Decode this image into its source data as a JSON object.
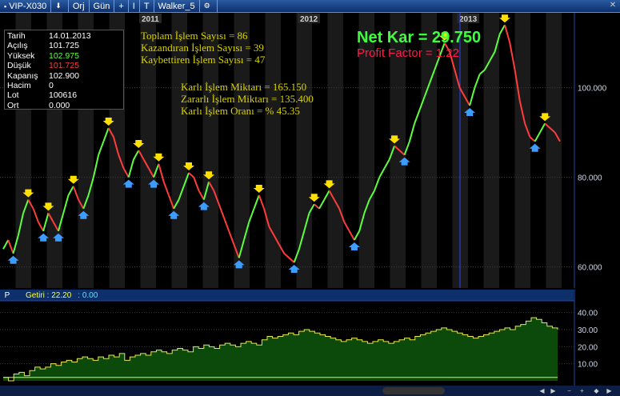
{
  "toolbar": {
    "symbol": "VIP-X030",
    "mode": "Orj",
    "period": "Gün",
    "plus_label": "+",
    "info_label": "I",
    "text_label": "T",
    "system": "Walker_5"
  },
  "info": {
    "rows": [
      {
        "k": "Tarih",
        "v": "14.01.2013"
      },
      {
        "k": "Açılış",
        "v": "101.725"
      },
      {
        "k": "Yüksek",
        "v": "102.975"
      },
      {
        "k": "Düşük",
        "v": "101.725"
      },
      {
        "k": "Kapanış",
        "v": "102.900"
      },
      {
        "k": "Hacim",
        "v": "0"
      },
      {
        "k": "Lot",
        "v": "100616"
      },
      {
        "k": "Ort",
        "v": "0.000"
      }
    ]
  },
  "stats": {
    "toplam": "Toplam İşlem Sayısı =  86",
    "kazandiran": "Kazandıran İşlem Sayısı =  39",
    "kaybettiren": "Kaybettiren İşlem Sayısı =  47",
    "karli_miktar": "Karlı İşlem Miktarı =  165.150",
    "zararli_miktar": "Zararlı İşlem Miktarı =  135.400",
    "karli_oran": "Karlı İşlem Oranı = % 45.35",
    "net_kar": "Net Kar =  29.750",
    "profit_factor": "Profit Factor =  1.22"
  },
  "sub": {
    "panel_label": "P",
    "getiri": "Getiri : 22.20",
    "zero": ": 0.00"
  },
  "colors": {
    "up": "#5cff3c",
    "down": "#ff3c3c",
    "buy_arrow": "#3c9cff",
    "sell_arrow": "#ffe000",
    "equity_fill": "#0c4a0c",
    "equity_line": "#e8e84a"
  },
  "chart_data": [
    {
      "type": "line",
      "title": "",
      "x_tick_labels": [
        "2011",
        "2012",
        "2013"
      ],
      "y_tick_labels": [
        "60.000",
        "80.000",
        "100.000"
      ],
      "ylim": [
        56,
        116
      ],
      "series": [
        {
          "values": [
            64,
            66,
            63,
            67,
            72,
            75,
            73,
            70,
            68,
            72,
            70,
            68,
            72,
            76,
            78,
            75,
            73,
            76,
            80,
            85,
            88,
            91,
            89,
            85,
            82,
            80,
            84,
            86,
            84,
            82,
            80,
            83,
            79,
            76,
            73,
            75,
            78,
            81,
            80,
            77,
            75,
            79,
            77,
            74,
            71,
            68,
            65,
            62,
            66,
            70,
            73,
            76,
            73,
            69,
            67,
            65,
            63,
            62,
            61,
            64,
            68,
            72,
            74,
            73,
            75,
            77,
            75,
            73,
            70,
            68,
            66,
            68,
            72,
            75,
            77,
            80,
            82,
            84,
            87,
            86,
            85,
            88,
            92,
            95,
            98,
            101,
            104,
            107,
            110,
            108,
            104,
            100,
            98,
            96,
            100,
            103,
            104,
            106,
            108,
            112,
            114,
            110,
            104,
            97,
            92,
            89,
            88,
            90,
            92,
            91,
            90,
            88
          ]
        }
      ]
    },
    {
      "type": "area",
      "title": "",
      "y_tick_labels": [
        "10.00",
        "20.00",
        "30.00",
        "40.00"
      ],
      "ylim": [
        0,
        45
      ],
      "series": [
        {
          "values": [
            2,
            0,
            4,
            5,
            3,
            6,
            8,
            7,
            8,
            10,
            9,
            11,
            12,
            11,
            13,
            14,
            13,
            12,
            14,
            13,
            15,
            14,
            16,
            12,
            14,
            15,
            16,
            15,
            17,
            18,
            17,
            16,
            18,
            19,
            18,
            17,
            20,
            19,
            21,
            20,
            19,
            21,
            22,
            21,
            20,
            22,
            23,
            22,
            21,
            24,
            26,
            25,
            26,
            27,
            28,
            27,
            29,
            30,
            29,
            28,
            27,
            26,
            25,
            24,
            23,
            24,
            25,
            24,
            23,
            22,
            23,
            24,
            23,
            22,
            23,
            24,
            25,
            24,
            26,
            27,
            28,
            29,
            30,
            31,
            30,
            29,
            28,
            27,
            26,
            25,
            26,
            27,
            28,
            29,
            30,
            31,
            30,
            32,
            33,
            35,
            37,
            36,
            34,
            32,
            31,
            30
          ]
        }
      ]
    }
  ]
}
